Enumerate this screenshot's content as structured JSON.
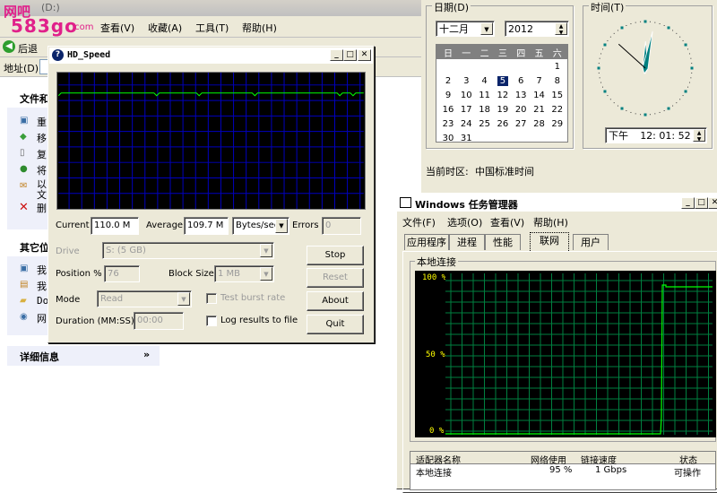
{
  "watermark": {
    "line1": "网吧",
    "line2": "583go",
    "suffix": ".com"
  },
  "explorer": {
    "title": "(D:)",
    "menu": [
      "查看(V)",
      "收藏(A)",
      "工具(T)",
      "帮助(H)"
    ],
    "back_label": "后退",
    "address_label": "地址(D)",
    "file_tasks_title": "文件和",
    "file_tasks": [
      "重",
      "移",
      "复",
      "将",
      "以文",
      "删"
    ],
    "other_title": "其它位",
    "other_items": [
      "我",
      "我",
      "Do",
      "网"
    ],
    "details_title": "详细信息"
  },
  "datetime": {
    "date_label": "日期(D)",
    "month": "十二月",
    "year": "2012",
    "weekdays": [
      "日",
      "一",
      "二",
      "三",
      "四",
      "五",
      "六"
    ],
    "weeks": [
      [
        "",
        "",
        "",
        "",
        "",
        "",
        "1"
      ],
      [
        "2",
        "3",
        "4",
        "5",
        "6",
        "7",
        "8"
      ],
      [
        "9",
        "10",
        "11",
        "12",
        "13",
        "14",
        "15"
      ],
      [
        "16",
        "17",
        "18",
        "19",
        "20",
        "21",
        "22"
      ],
      [
        "23",
        "24",
        "25",
        "26",
        "27",
        "28",
        "29"
      ],
      [
        "30",
        "31",
        "",
        "",
        "",
        "",
        ""
      ]
    ],
    "selected_day": "5",
    "time_label": "时间(T)",
    "ampm": "下午",
    "time": "12: 01: 52",
    "timezone_label": "当前时区:",
    "timezone": "中国标准时间",
    "clock": {
      "hour": 12,
      "minute": 1,
      "second": 52
    }
  },
  "hdspeed": {
    "title": "HD_Speed",
    "current_label": "Current",
    "current_value": "110.0 M",
    "average_label": "Average",
    "average_value": "109.7 M",
    "unit": "Bytes/sec",
    "errors_label": "Errors",
    "errors_value": "0",
    "drive_label": "Drive",
    "drive_value": "S: (5 GB)",
    "position_label": "Position %",
    "position_value": "76",
    "blocksize_label": "Block Size",
    "blocksize_value": "1 MB",
    "mode_label": "Mode",
    "mode_value": "Read",
    "burst_label": "Test burst rate",
    "duration_label": "Duration (MM:SS)",
    "duration_value": "00:00",
    "log_label": "Log results to file",
    "buttons": {
      "stop": "Stop",
      "reset": "Reset",
      "about": "About",
      "quit": "Quit"
    },
    "graph_level": 0.85
  },
  "taskmgr": {
    "title": "Windows 任务管理器",
    "menu": [
      "文件(F)",
      "选项(O)",
      "查看(V)",
      "帮助(H)"
    ],
    "tabs": [
      "应用程序",
      "进程",
      "性能",
      "联网",
      "用户"
    ],
    "active_tab": "联网",
    "group_label": "本地连接",
    "y_labels": [
      "100 %",
      "50 %",
      "0 %"
    ],
    "columns": [
      "适配器名称",
      "网络使用",
      "链接速度",
      "状态"
    ],
    "row": {
      "name": "本地连接",
      "usage": "95 %",
      "speed": "1 Gbps",
      "state": "可操作"
    },
    "usage_level": 0.95
  },
  "colors": {
    "graph_green": "#00ff00",
    "graph_grid_hd": "#0000c0",
    "graph_grid_tm": "#008040",
    "title_blue": "#0a246a"
  }
}
